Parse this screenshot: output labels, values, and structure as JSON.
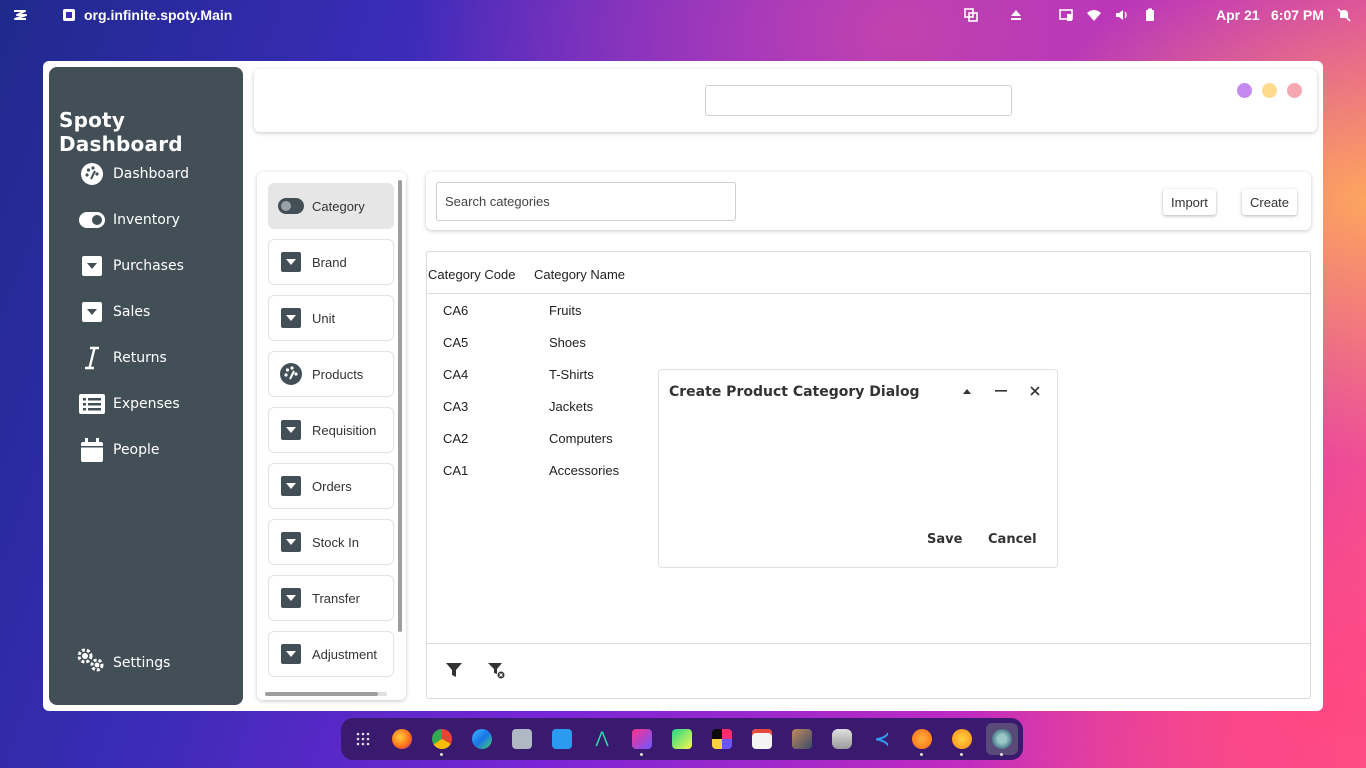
{
  "topbar": {
    "app_name": "org.infinite.spoty.Main",
    "date": "Apr 21",
    "time": "6:07 PM"
  },
  "sidebar": {
    "brand": "Spoty Dashboard",
    "items": [
      {
        "label": "Dashboard",
        "icon": "dashboard-icon"
      },
      {
        "label": "Inventory",
        "icon": "toggle-icon"
      },
      {
        "label": "Purchases",
        "icon": "dropdown-box-icon"
      },
      {
        "label": "Sales",
        "icon": "dropdown-box-icon"
      },
      {
        "label": "Returns",
        "icon": "italic-i-icon"
      },
      {
        "label": "Expenses",
        "icon": "list-icon"
      },
      {
        "label": "People",
        "icon": "calendar-icon"
      }
    ],
    "settings": "Settings"
  },
  "submenu": {
    "items": [
      {
        "label": "Category",
        "icon": "toggle-icon",
        "active": true
      },
      {
        "label": "Brand",
        "icon": "dropdown-box-icon"
      },
      {
        "label": "Unit",
        "icon": "dropdown-box-icon"
      },
      {
        "label": "Products",
        "icon": "dashboard-icon"
      },
      {
        "label": "Requisition",
        "icon": "dropdown-box-icon"
      },
      {
        "label": "Orders",
        "icon": "dropdown-box-icon"
      },
      {
        "label": "Stock In",
        "icon": "dropdown-box-icon"
      },
      {
        "label": "Transfer",
        "icon": "dropdown-box-icon"
      },
      {
        "label": "Adjustment",
        "icon": "dropdown-box-icon"
      }
    ]
  },
  "toolbar": {
    "search_placeholder": "Search categories",
    "import_label": "Import",
    "create_label": "Create"
  },
  "table": {
    "columns": [
      "Category Code",
      "Category Name"
    ],
    "rows": [
      [
        "CA6",
        "Fruits"
      ],
      [
        "CA5",
        "Shoes"
      ],
      [
        "CA4",
        "T-Shirts"
      ],
      [
        "CA3",
        "Jackets"
      ],
      [
        "CA2",
        "Computers"
      ],
      [
        "CA1",
        "Accessories"
      ]
    ]
  },
  "dialog": {
    "title": "Create Product Category Dialog",
    "save_label": "Save",
    "cancel_label": "Cancel"
  },
  "colors": {
    "sidebar_bg": "#434f56",
    "dot_purple": "#c58af0",
    "dot_yellow": "#ffd98c",
    "dot_pink": "#f5a8b0"
  }
}
